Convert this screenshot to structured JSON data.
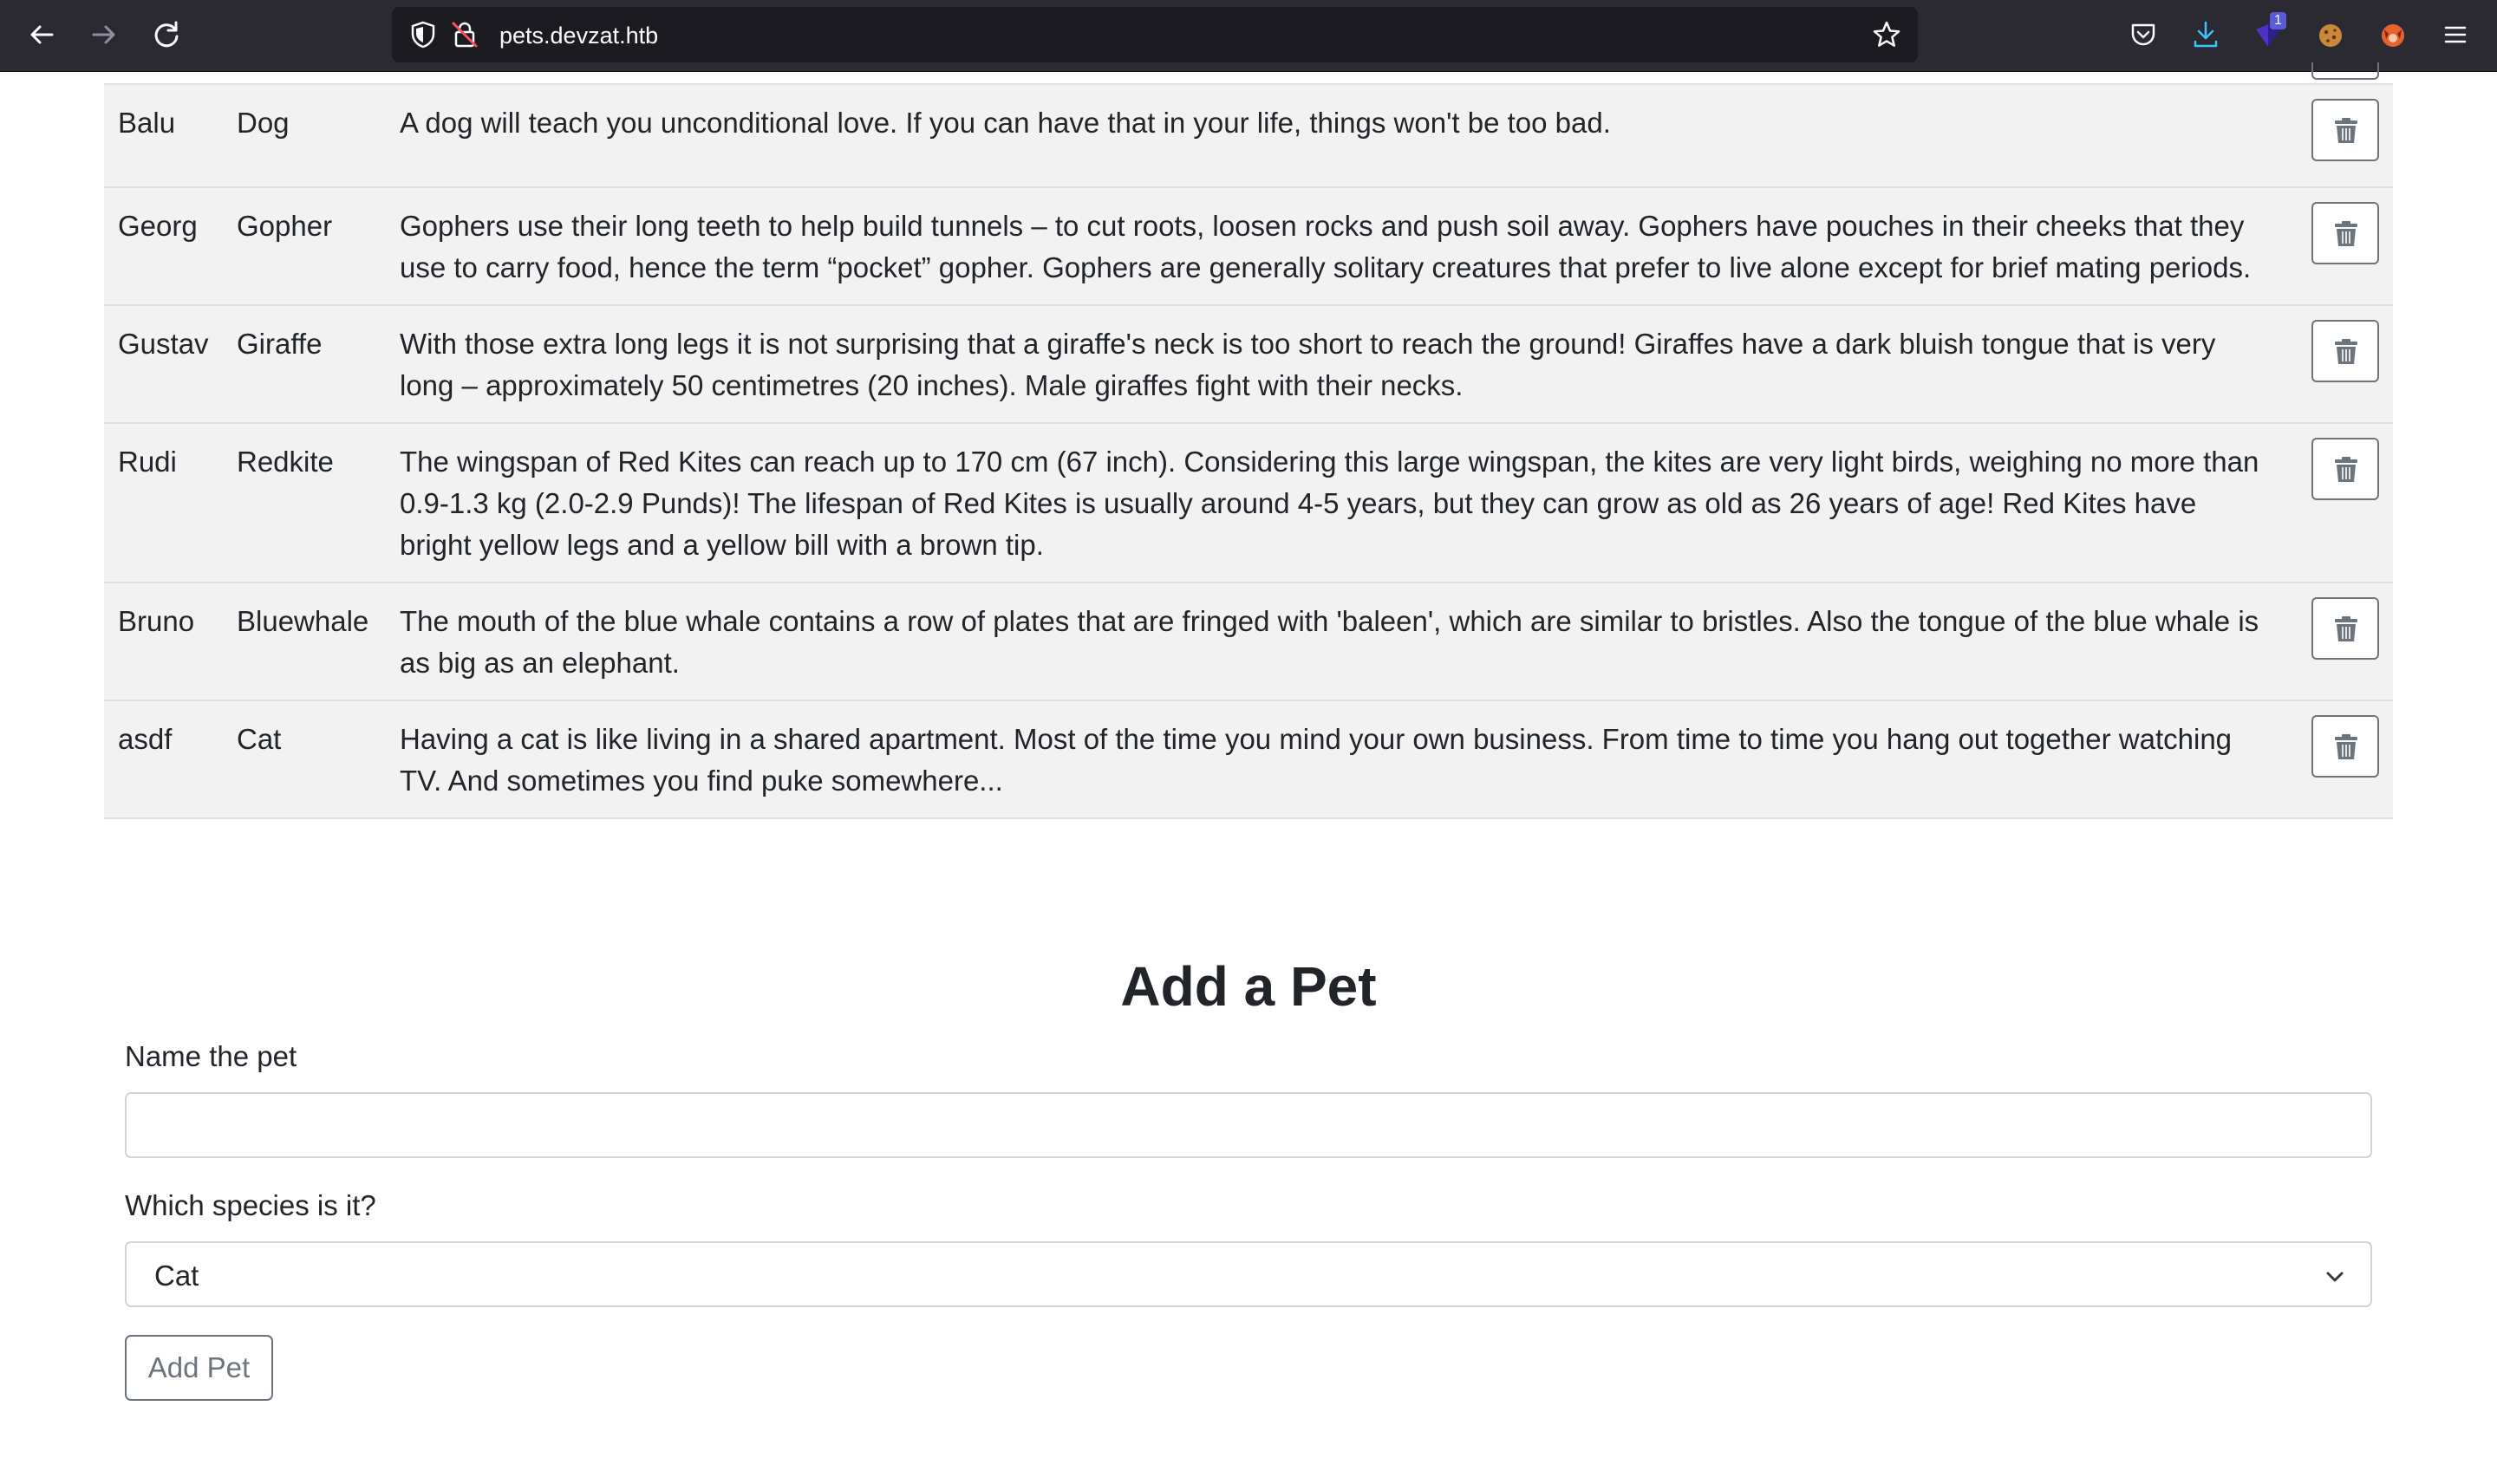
{
  "browser": {
    "url": "pets.devzat.htb",
    "extension_badge": "1"
  },
  "pets": [
    {
      "name": "Balu",
      "species": "Dog",
      "description": "A dog will teach you unconditional love. If you can have that in your life, things won't be too bad."
    },
    {
      "name": "Georg",
      "species": "Gopher",
      "description": "Gophers use their long teeth to help build tunnels – to cut roots, loosen rocks and push soil away. Gophers have pouches in their cheeks that they use to carry food, hence the term “pocket” gopher. Gophers are generally solitary creatures that prefer to live alone except for brief mating periods."
    },
    {
      "name": "Gustav",
      "species": "Giraffe",
      "description": "With those extra long legs it is not surprising that a giraffe's neck is too short to reach the ground! Giraffes have a dark bluish tongue that is very long – approximately 50 centimetres (20 inches). Male giraffes fight with their necks."
    },
    {
      "name": "Rudi",
      "species": "Redkite",
      "description": "The wingspan of Red Kites can reach up to 170 cm (67 inch). Considering this large wingspan, the kites are very light birds, weighing no more than 0.9-1.3 kg (2.0-2.9 Punds)! The lifespan of Red Kites is usually around 4-5 years, but they can grow as old as 26 years of age! Red Kites have bright yellow legs and a yellow bill with a brown tip."
    },
    {
      "name": "Bruno",
      "species": "Bluewhale",
      "description": "The mouth of the blue whale contains a row of plates that are fringed with 'baleen', which are similar to bristles. Also the tongue of the blue whale is as big as an elephant."
    },
    {
      "name": "asdf",
      "species": "Cat",
      "description": "Having a cat is like living in a shared apartment. Most of the time you mind your own business. From time to time you hang out together watching TV. And sometimes you find puke somewhere..."
    }
  ],
  "form": {
    "title": "Add a Pet",
    "name_label": "Name the pet",
    "name_value": "",
    "species_label": "Which species is it?",
    "species_selected": "Cat",
    "submit_label": "Add Pet"
  },
  "colors": {
    "toolbar_bg": "#2b2a33",
    "urlbar_bg": "#1c1b22",
    "stripe_bg": "#f2f2f2",
    "button_border": "#6c757d"
  }
}
